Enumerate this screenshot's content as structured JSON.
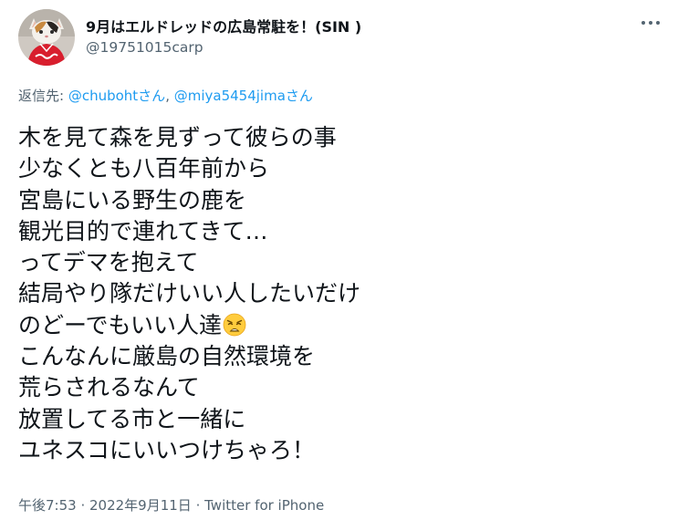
{
  "author": {
    "display_name": "9月はエルドレッドの広島常駐を！(SIN )",
    "handle": "@19751015carp"
  },
  "header": {
    "more_icon": "more-horizontal-icon"
  },
  "reply": {
    "prefix": "返信先: ",
    "mention_1": "@chubohtさん",
    "separator": ", ",
    "mention_2": "@miya5454jimaさん"
  },
  "tweet": {
    "lines": [
      "木を見て森を見ずって彼らの事",
      "少なくとも八百年前から",
      "宮島にいる野生の鹿を",
      "観光目的で連れてきて…",
      "ってデマを抱えて",
      "結局やり隊だけいい人したいだけ",
      "のどーでもいい人達",
      "こんなんに厳島の自然環境を",
      "荒らされるなんて",
      "放置してる市と一緒に",
      "ユネスコにいいつけちゃろ！"
    ],
    "emoji_after_line_7": "weary-face-emoji"
  },
  "meta": {
    "time": "午後7:53",
    "sep_1": " · ",
    "date": "2022年9月11日",
    "sep_2": " · ",
    "source": "Twitter for iPhone"
  },
  "colors": {
    "text": "#0f1419",
    "secondary": "#536471",
    "link": "#1d9bf0",
    "carp_red": "#d81e2d"
  }
}
